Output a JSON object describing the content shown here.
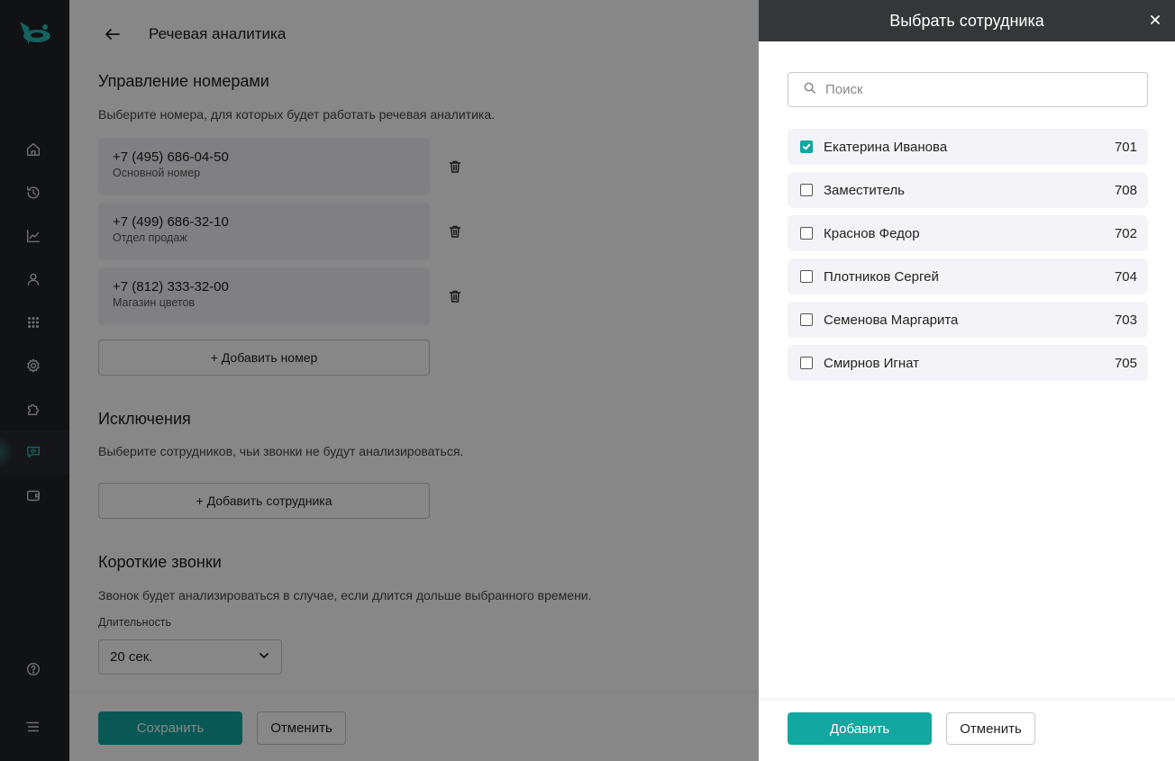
{
  "header": {
    "page_title": "Речевая аналитика"
  },
  "numbers_section": {
    "title": "Управление номерами",
    "description": "Выберите номера, для которых будет работать речевая аналитика.",
    "phones": [
      {
        "number": "+7 (495) 686-04-50",
        "label": "Основной номер"
      },
      {
        "number": "+7 (499) 686-32-10",
        "label": "Отдел продаж"
      },
      {
        "number": "+7 (812) 333-32-00",
        "label": "Магазин цветов"
      }
    ],
    "add_button": "+ Добавить номер"
  },
  "exclusions_section": {
    "title": "Исключения",
    "description": "Выберите сотрудников, чьи звонки не будут анализироваться.",
    "add_button": "+ Добавить сотрудника"
  },
  "short_calls_section": {
    "title": "Короткие звонки",
    "description": "Звонок будет анализироваться в случае, если длится дольше выбранного времени.",
    "duration_label": "Длительность",
    "duration_value": "20 сек."
  },
  "footer": {
    "save": "Сохранить",
    "cancel": "Отменить"
  },
  "drawer": {
    "title": "Выбрать сотрудника",
    "search_placeholder": "Поиск",
    "employees": [
      {
        "name": "Екатерина Иванова",
        "ext": "701",
        "checked": true
      },
      {
        "name": "Заместитель",
        "ext": "708",
        "checked": false
      },
      {
        "name": "Краснов Федор",
        "ext": "702",
        "checked": false
      },
      {
        "name": "Плотников Сергей",
        "ext": "704",
        "checked": false
      },
      {
        "name": "Семенова Маргарита",
        "ext": "703",
        "checked": false
      },
      {
        "name": "Смирнов Игнат",
        "ext": "705",
        "checked": false
      }
    ],
    "add": "Добавить",
    "cancel": "Отменить"
  },
  "colors": {
    "accent": "#12a7a0",
    "sidebar": "#1f2227",
    "drawer_header": "#343638"
  },
  "icons": {
    "sidebar": [
      "home-icon",
      "history-icon",
      "analytics-icon",
      "user-icon",
      "dialpad-icon",
      "settings-icon",
      "integrations-icon",
      "speech-analytics-icon",
      "wallet-icon",
      "help-icon",
      "menu-icon"
    ]
  }
}
